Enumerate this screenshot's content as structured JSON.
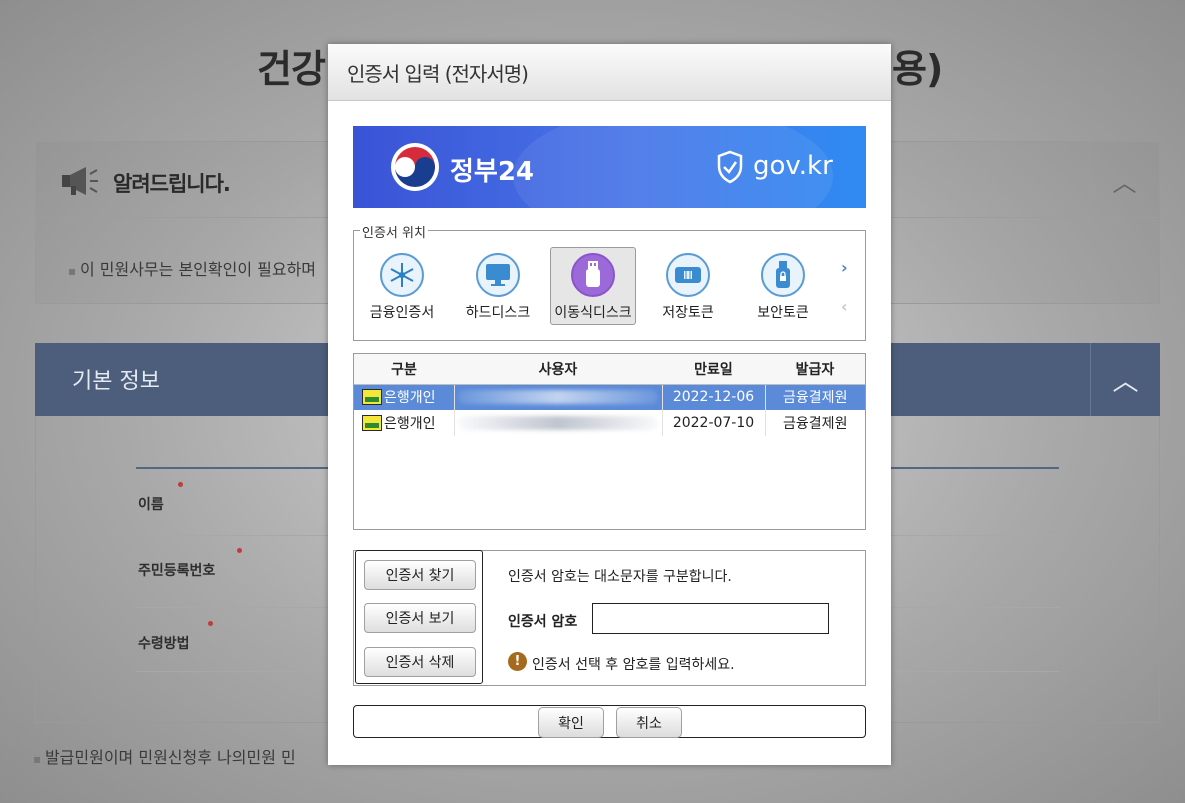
{
  "background": {
    "title_left": "건강",
    "title_right": "용)",
    "notice": {
      "title": "알려드립니다.",
      "text": "이 민원사무는 본인확인이 필요하며",
      "collapse": "︿"
    },
    "basic_info": {
      "title": "기본 정보",
      "collapse": "︿",
      "fields": [
        "이름",
        "주민등록번호",
        "수령방법"
      ]
    },
    "footnote": "발급민원이며 민원신청후 나의민원 민"
  },
  "dialog": {
    "title": "인증서 입력 (전자서명)",
    "banner": {
      "logo_text": "정부24",
      "domain": "gov.kr"
    },
    "location": {
      "legend": "인증서 위치",
      "items": [
        {
          "label": "금융인증서",
          "icon": "cloud-certificate-icon",
          "selected": false
        },
        {
          "label": "하드디스크",
          "icon": "monitor-icon",
          "selected": false
        },
        {
          "label": "이동식디스크",
          "icon": "usb-icon",
          "selected": true
        },
        {
          "label": "저장토큰",
          "icon": "token-icon",
          "selected": false
        },
        {
          "label": "보안토큰",
          "icon": "secure-usb-icon",
          "selected": false
        }
      ],
      "next_arrow": "›",
      "prev_arrow": "‹"
    },
    "cert_table": {
      "headers": [
        "구분",
        "사용자",
        "만료일",
        "발급자"
      ],
      "rows": [
        {
          "type": "은행개인",
          "expiry": "2022-12-06",
          "issuer": "금융결제원",
          "selected": true
        },
        {
          "type": "은행개인",
          "expiry": "2022-07-10",
          "issuer": "금융결제원",
          "selected": false
        }
      ]
    },
    "actions": {
      "find": "인증서 찾기",
      "view": "인증서 보기",
      "delete": "인증서 삭제",
      "case_hint": "인증서 암호는 대소문자를 구분합니다.",
      "password_label": "인증서 암호",
      "password_value": "",
      "warning_symbol": "!",
      "warning": "인증서 선택 후 암호를 입력하세요."
    },
    "footer": {
      "confirm": "확인",
      "cancel": "취소"
    }
  },
  "colors": {
    "banner_start": "#3a53d6",
    "banner_end": "#2f8bf2",
    "selected_row": "#5a8ad8",
    "selected_location": "#9b6ad8",
    "basic_bar": "#4c5e7c"
  }
}
